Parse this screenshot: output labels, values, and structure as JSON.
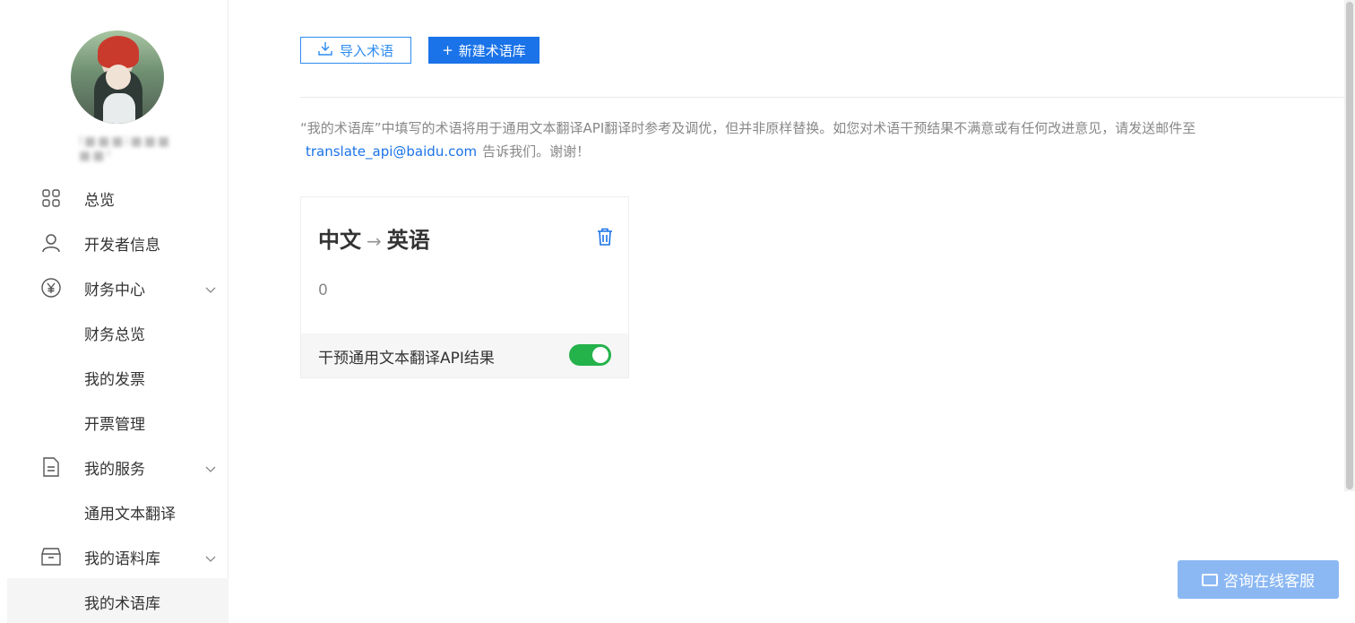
{
  "sidebar": {
    "username": "l■■■i■■■ ■■²",
    "items": [
      {
        "label": "总览",
        "icon": "grid-icon"
      },
      {
        "label": "开发者信息",
        "icon": "user-icon"
      },
      {
        "label": "财务中心",
        "icon": "yuan-icon",
        "expandable": true
      },
      {
        "label": "财务总览"
      },
      {
        "label": "我的发票"
      },
      {
        "label": "开票管理"
      },
      {
        "label": "我的服务",
        "icon": "document-icon",
        "expandable": true
      },
      {
        "label": "通用文本翻译"
      },
      {
        "label": "我的语料库",
        "icon": "box-icon",
        "expandable": true
      },
      {
        "label": "我的术语库",
        "active": true
      }
    ]
  },
  "toolbar": {
    "import_label": "导入术语",
    "new_label": "新建术语库"
  },
  "notice": {
    "text": "“我的术语库”中填写的术语将用于通用文本翻译API翻译时参考及调优，但并非原样替换。如您对术语干预结果不满意或有任何改进意见，请发送邮件至",
    "email": "translate_api@baidu.com",
    "suffix": "告诉我们。谢谢！"
  },
  "card": {
    "source_lang": "中文",
    "arrow": "→",
    "target_lang": "英语",
    "count": "0",
    "toggle_label": "干预通用文本翻译API结果",
    "toggle_on": true
  },
  "chat": {
    "label": "咨询在线客服"
  },
  "colors": {
    "accent": "#1a73e8",
    "toggle_on": "#24b24b"
  }
}
